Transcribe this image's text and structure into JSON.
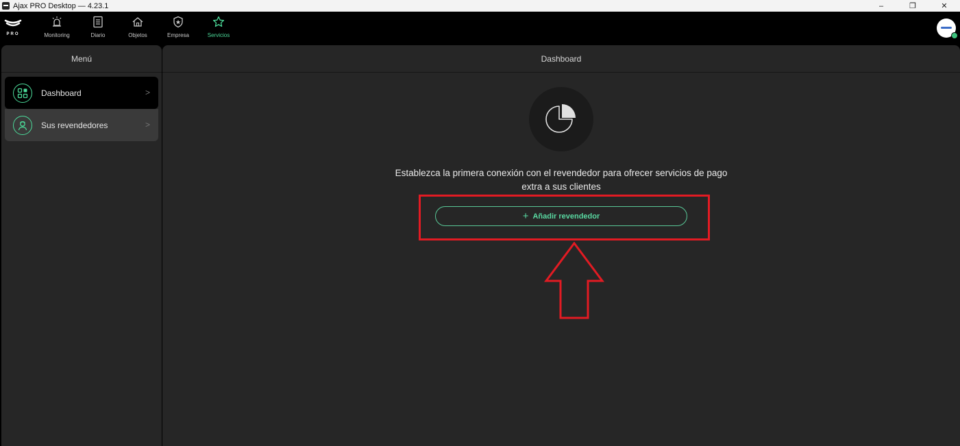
{
  "window": {
    "title": "Ajax PRO Desktop  —  4.23.1",
    "controls": [
      "–",
      "❐",
      "✕"
    ]
  },
  "brand": {
    "logo_text": "PRO"
  },
  "nav": {
    "items": [
      {
        "label": "Monitoring",
        "icon": "alarm-icon"
      },
      {
        "label": "Diario",
        "icon": "journal-icon"
      },
      {
        "label": "Objetos",
        "icon": "house-icon"
      },
      {
        "label": "Empresa",
        "icon": "shield-icon"
      },
      {
        "label": "Servicios",
        "icon": "star-icon",
        "active": true
      }
    ]
  },
  "sidebar": {
    "header": "Menú",
    "items": [
      {
        "label": "Dashboard",
        "icon": "dashboard-icon",
        "selected": true
      },
      {
        "label": "Sus revendedores",
        "icon": "reseller-icon"
      }
    ]
  },
  "main": {
    "header": "Dashboard",
    "empty_icon": "pie-chart-icon",
    "empty_message": "Establezca la primera conexión con el revendedor para ofrecer servicios de pago extra a sus clientes",
    "add_button": {
      "plus": "+",
      "label": "Añadir revendedor"
    }
  },
  "colors": {
    "accent": "#4cdb9a",
    "panel": "#262626",
    "background": "#000000",
    "annotation": "#e21b23"
  }
}
